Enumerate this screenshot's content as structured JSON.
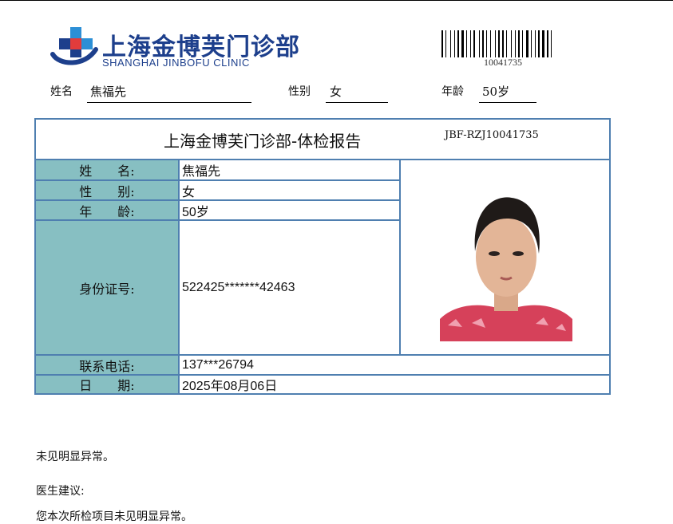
{
  "header": {
    "logo_cn": "上海金博芙门诊部",
    "logo_en": "SHANGHAI JINBOFU CLINIC",
    "barcode_number": "10041735"
  },
  "info": {
    "name_label": "姓名",
    "name_value": "焦福先",
    "gender_label": "性别",
    "gender_value": "女",
    "age_label": "年龄",
    "age_value": "50岁"
  },
  "report": {
    "title": "上海金博芙门诊部-体检报告",
    "code": "JBF-RZJ10041735",
    "rows": {
      "name_label": "姓　　名:",
      "name_value": "焦福先",
      "gender_label": "性　　别:",
      "gender_value": "女",
      "age_label": "年　　龄:",
      "age_value": "50岁",
      "id_label": "身份证号:",
      "id_value": "522425*******42463",
      "phone_label": "联系电话:",
      "phone_value": "137***26794",
      "date_label": "日　　期:",
      "date_value": "2025年08月06日"
    }
  },
  "body": {
    "finding": "未见明显异常。",
    "advice_label": "医生建议:",
    "advice_text": "您本次所检项目未见明显异常。"
  },
  "colors": {
    "label_bg": "#87bfc2",
    "border": "#4f7fb0",
    "brand": "#1d3f8c"
  }
}
